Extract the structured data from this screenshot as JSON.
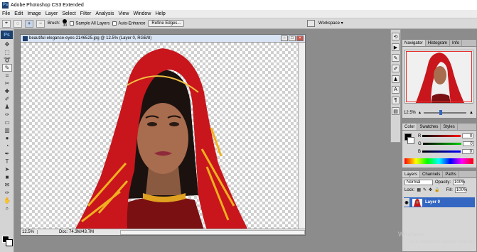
{
  "app": {
    "title": "Adobe Photoshop CS3 Extended",
    "logo": "Ps"
  },
  "menu": [
    "File",
    "Edit",
    "Image",
    "Layer",
    "Select",
    "Filter",
    "Analysis",
    "View",
    "Window",
    "Help"
  ],
  "options": {
    "brush_label": "Brush:",
    "brush_size": "30",
    "sample_all_layers": "Sample All Layers",
    "auto_enhance": "Auto-Enhance",
    "refine_edges": "Refine Edges...",
    "workspace": "Workspace ▾"
  },
  "document": {
    "title": "beautiful-elegance-eyes-2146525.jpg @ 12.5% (Layer 0, RGB/8)",
    "zoom": "12.5%",
    "doc_info": "Doc: 74.3M/43.7M"
  },
  "navigator": {
    "tabs": [
      "Navigator",
      "Histogram",
      "Info"
    ],
    "zoom": "12.5%"
  },
  "color": {
    "tabs": [
      "Color",
      "Swatches",
      "Styles"
    ],
    "channels": [
      {
        "label": "R",
        "value": "0"
      },
      {
        "label": "G",
        "value": "0"
      },
      {
        "label": "B",
        "value": "0"
      }
    ]
  },
  "layers": {
    "tabs": [
      "Layers",
      "Channels",
      "Paths"
    ],
    "blend_mode": "Normal",
    "opacity_label": "Opacity:",
    "opacity": "100%",
    "lock_label": "Lock:",
    "fill_label": "Fill:",
    "fill": "100%",
    "layer_name": "Layer 0"
  },
  "watermark": {
    "line1": "Windows",
    "line2": "Go to Settings to activate Windows."
  }
}
